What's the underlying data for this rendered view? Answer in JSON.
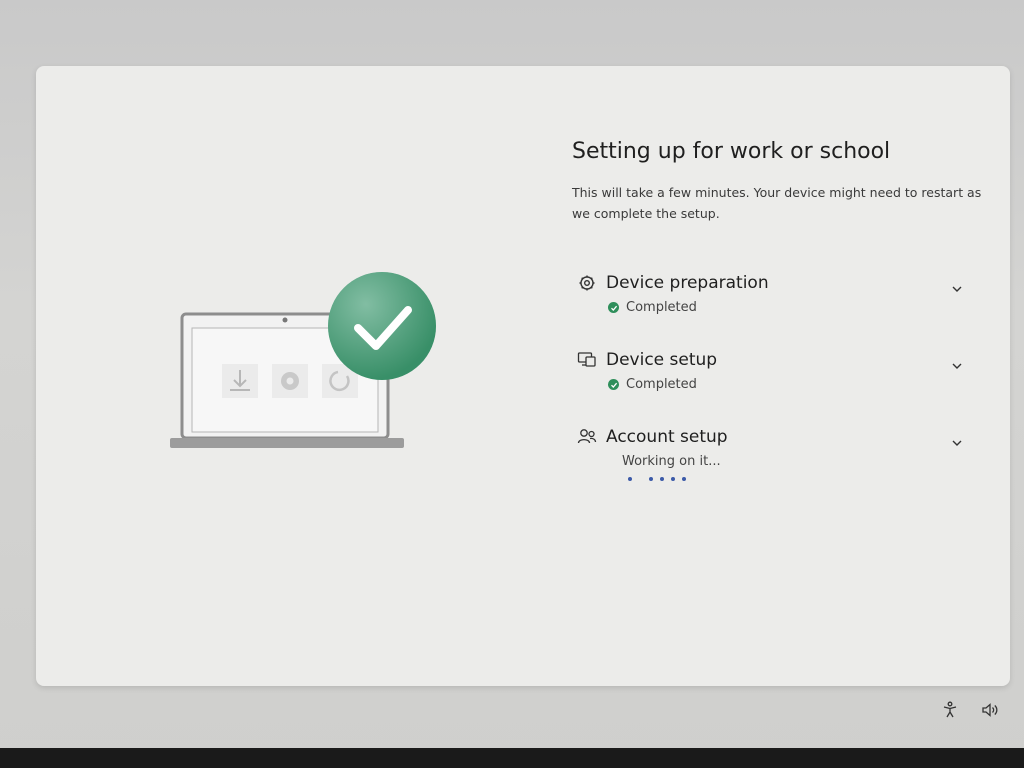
{
  "page": {
    "title": "Setting up for work or school",
    "subtitle": "This will take a few minutes. Your device might need to restart as we complete the setup."
  },
  "steps": [
    {
      "title": "Device preparation",
      "status": "Completed",
      "state": "completed",
      "icon": "gear-icon"
    },
    {
      "title": "Device setup",
      "status": "Completed",
      "state": "completed",
      "icon": "devices-icon"
    },
    {
      "title": "Account setup",
      "status": "Working on it...",
      "state": "in-progress",
      "icon": "people-icon"
    }
  ],
  "illustration": {
    "icons": [
      "download-icon",
      "gear-icon",
      "refresh-icon",
      "checkmark-icon"
    ]
  },
  "system_tray": {
    "icons": [
      "accessibility-icon",
      "volume-icon"
    ]
  },
  "colors": {
    "accent_green": "#2f8f5b",
    "progress_blue": "#3c5aa8",
    "card_background": "#ececea"
  }
}
